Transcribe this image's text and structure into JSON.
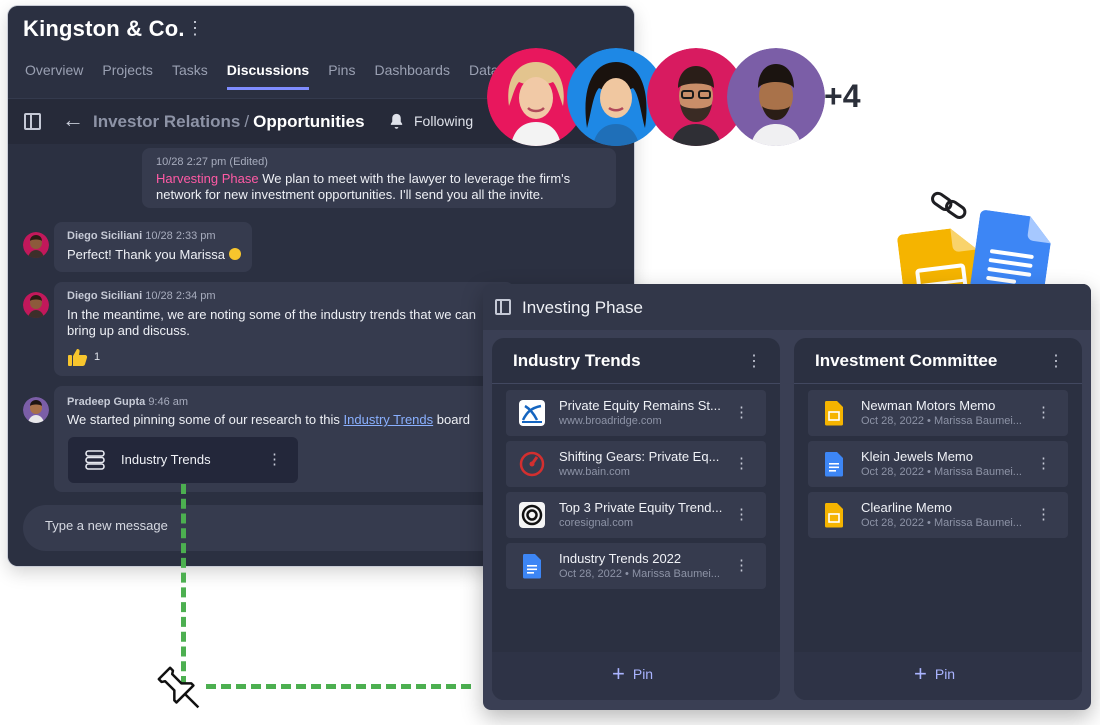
{
  "workspace": {
    "title": "Kingston & Co."
  },
  "tabs": [
    {
      "label": "Overview"
    },
    {
      "label": "Projects"
    },
    {
      "label": "Tasks"
    },
    {
      "label": "Discussions",
      "active": true
    },
    {
      "label": "Pins"
    },
    {
      "label": "Dashboards"
    },
    {
      "label": "Data Sou"
    }
  ],
  "breadcrumb": {
    "parent": "Investor Relations",
    "separator": "/",
    "current": "Opportunities"
  },
  "follow": {
    "label": "Following"
  },
  "messages": [
    {
      "timestamp": "10/28 2:27 pm",
      "edited": "(Edited)",
      "tag": "Harvesting Phase",
      "text_line1": "We plan to meet with the lawyer to leverage the firm's",
      "text_line2": "network for new investment opportunities. I'll send you all the invite."
    },
    {
      "author": "Diego Siciliani",
      "timestamp": "10/28 2:33 pm",
      "text": "Perfect! Thank you Marissa"
    },
    {
      "author": "Diego Siciliani",
      "timestamp": "10/28 2:34 pm",
      "text_line1": "In the meantime, we are noting some of the industry trends that we can",
      "text_line2": "bring up and discuss.",
      "reaction_count": "1"
    },
    {
      "author": "Pradeep Gupta",
      "timestamp": "9:46 am",
      "text_before": "We started pinning some of our research to this",
      "link": "Industry Trends",
      "text_after": "board",
      "board_card": "Industry Trends"
    }
  ],
  "composer": {
    "placeholder": "Type a new message"
  },
  "participants": {
    "extra_count": "+4"
  },
  "board": {
    "title": "Investing Phase",
    "columns": [
      {
        "title": "Industry Trends",
        "pin_label": "Pin",
        "cards": [
          {
            "title": "Private Equity Remains St...",
            "subtitle": "www.broadridge.com"
          },
          {
            "title": "Shifting Gears: Private Eq...",
            "subtitle": "www.bain.com"
          },
          {
            "title": "Top 3 Private Equity Trend...",
            "subtitle": "coresignal.com"
          },
          {
            "title": "Industry Trends 2022",
            "subtitle": "Oct 28, 2022 • Marissa Baumei..."
          }
        ]
      },
      {
        "title": "Investment Committee",
        "pin_label": "Pin",
        "cards": [
          {
            "title": "Newman Motors Memo",
            "subtitle": "Oct 28, 2022 • Marissa Baumei..."
          },
          {
            "title": "Klein Jewels Memo",
            "subtitle": "Oct 28, 2022 • Marissa Baumei..."
          },
          {
            "title": "Clearline Memo",
            "subtitle": "Oct 28, 2022 • Marissa Baumei..."
          }
        ]
      }
    ]
  },
  "colors": {
    "panel": "#2b3041",
    "card": "#363b4e",
    "accent": "#7f8cff",
    "tag_pink": "#ff5aa5",
    "link": "#8ab0ff",
    "dash_green": "#4caf50"
  }
}
